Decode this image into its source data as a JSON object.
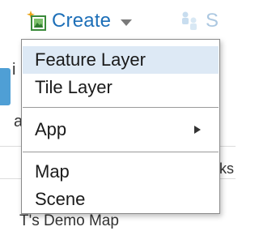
{
  "toolbar": {
    "create_label": "Create",
    "create_icon": "add-content-icon",
    "share_label": "S",
    "share_icon": "share-icon"
  },
  "dropdown": {
    "items": [
      {
        "label": "Feature Layer",
        "highlighted": true
      },
      {
        "label": "Tile Layer"
      },
      {
        "label": "App",
        "has_submenu": true
      },
      {
        "label": "Map"
      },
      {
        "label": "Scene"
      }
    ]
  },
  "background": {
    "fragment_top_left": "i",
    "fragment_mid_left": "a",
    "fragment_mid_right": "ks",
    "bottom_item_title": "T's Demo Map"
  },
  "colors": {
    "accent_blue": "#1d6fb8",
    "highlight_bg": "#dde9f5",
    "left_accent": "#4f9fd5"
  }
}
